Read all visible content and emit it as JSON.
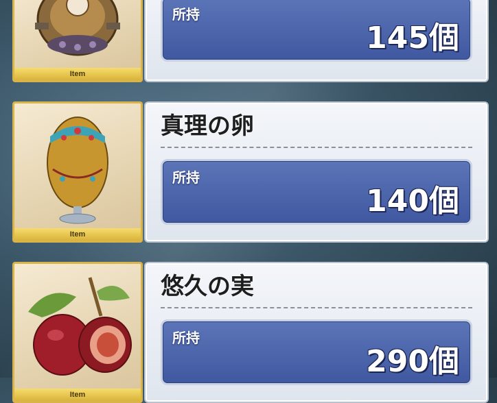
{
  "items": [
    {
      "name": "",
      "badge": "Item",
      "owned_label": "所持",
      "count": "145個",
      "icon": "orb-machine-icon"
    },
    {
      "name": "真理の卵",
      "badge": "Item",
      "owned_label": "所持",
      "count": "140個",
      "icon": "golden-egg-icon"
    },
    {
      "name": "悠久の実",
      "badge": "Item",
      "owned_label": "所持",
      "count": "290個",
      "icon": "fig-fruit-icon"
    }
  ],
  "colors": {
    "badge_gold": "#d8b44a",
    "owned_box_blue": "#4a63aa"
  }
}
